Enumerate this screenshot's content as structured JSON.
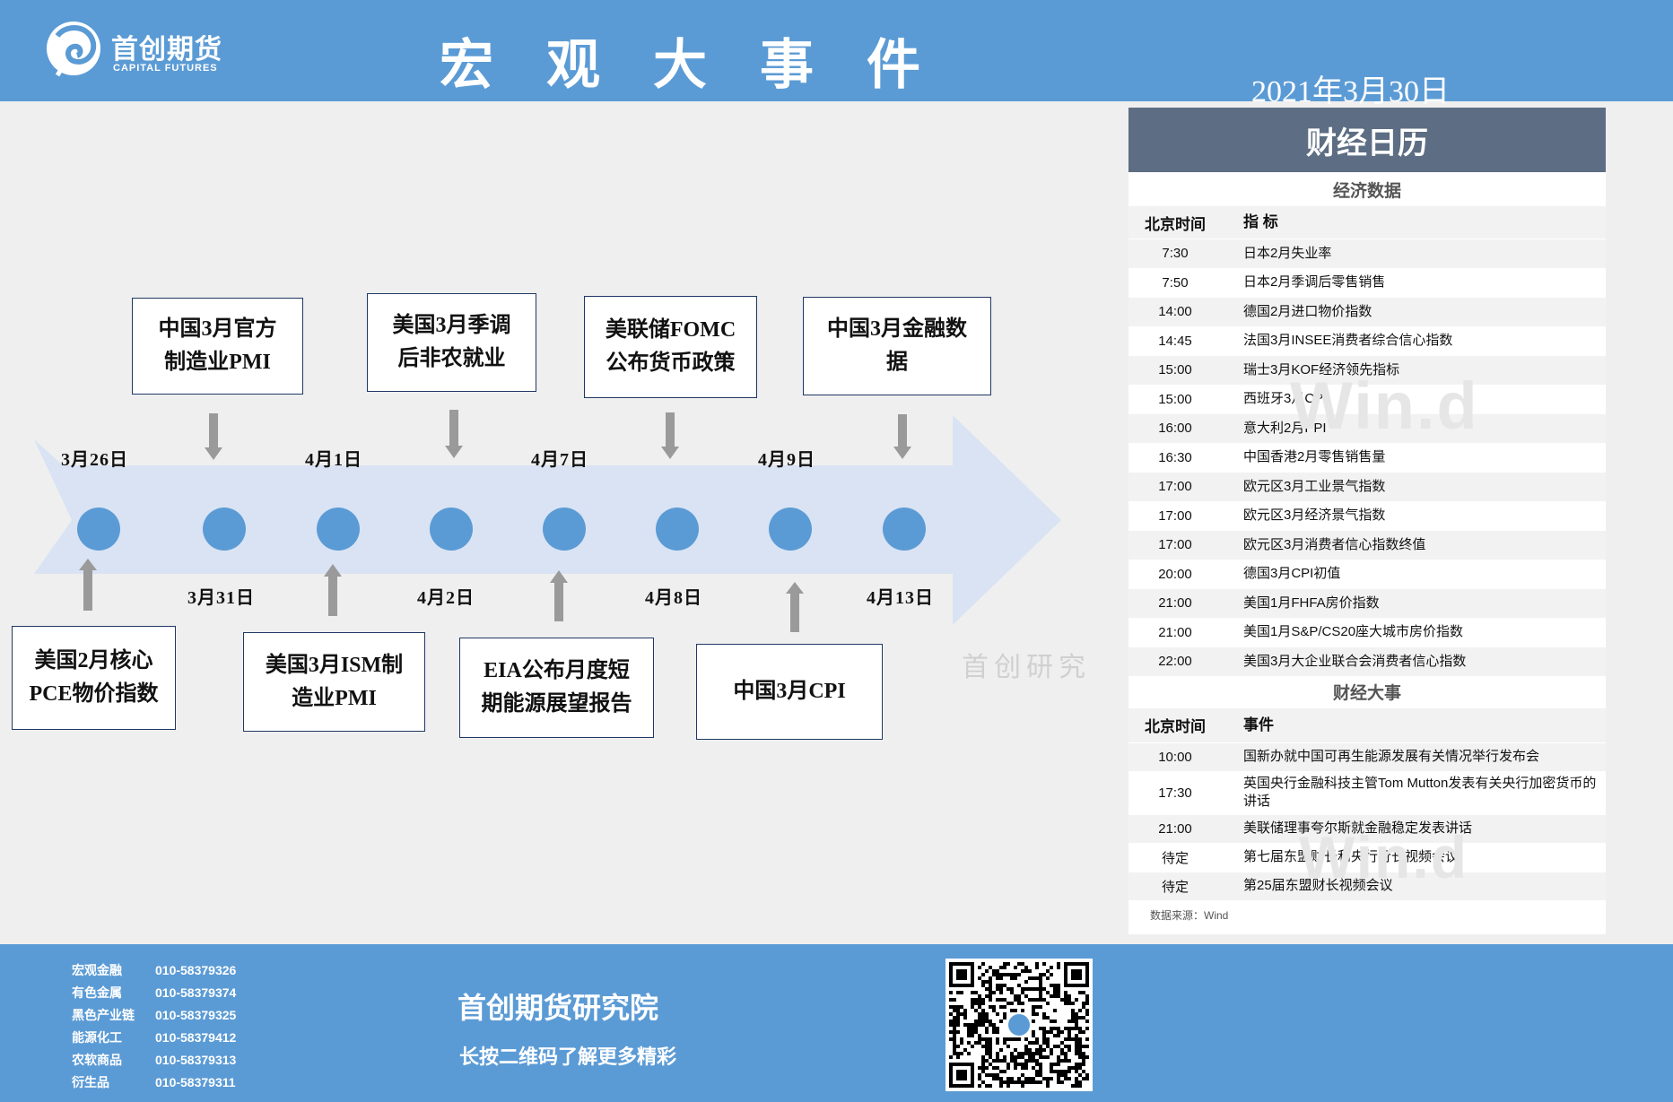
{
  "header": {
    "logo_cn": "首创期货",
    "logo_en": "CAPITAL FUTURES",
    "title": "宏 观 大 事 件",
    "date": "2021年3月30日"
  },
  "timeline": {
    "top_events": [
      {
        "line1": "中国3月官方",
        "line2": "制造业PMI"
      },
      {
        "line1": "美国3月季调",
        "line2": "后非农就业"
      },
      {
        "line1": "美联储FOMC",
        "line2": "公布货币政策"
      },
      {
        "line1": "中国3月金融数",
        "line2": "据"
      }
    ],
    "bottom_events": [
      {
        "line1": "美国2月核心",
        "line2": "PCE物价指数"
      },
      {
        "line1": "美国3月ISM制",
        "line2": "造业PMI"
      },
      {
        "line1": "EIA公布月度短",
        "line2": "期能源展望报告"
      },
      {
        "line1": "中国3月CPI",
        "line2": ""
      }
    ],
    "top_dates": [
      "3月26日",
      "4月1日",
      "4月7日",
      "4月9日"
    ],
    "bottom_dates": [
      "3月31日",
      "4月2日",
      "4月8日",
      "4月13日"
    ],
    "watermark": "首创研究"
  },
  "calendar": {
    "title": "财经日历",
    "economic": {
      "section_title": "经济数据",
      "col_time": "北京时间",
      "col_item": "指  标",
      "rows": [
        {
          "time": "7:30",
          "item": "日本2月失业率"
        },
        {
          "time": "7:50",
          "item": "日本2月季调后零售销售"
        },
        {
          "time": "14:00",
          "item": "德国2月进口物价指数"
        },
        {
          "time": "14:45",
          "item": "法国3月INSEE消费者综合信心指数"
        },
        {
          "time": "15:00",
          "item": "瑞士3月KOF经济领先指标"
        },
        {
          "time": "15:00",
          "item": "西班牙3月CPI"
        },
        {
          "time": "16:00",
          "item": "意大利2月PPI"
        },
        {
          "time": "16:30",
          "item": "中国香港2月零售销售量"
        },
        {
          "time": "17:00",
          "item": "欧元区3月工业景气指数"
        },
        {
          "time": "17:00",
          "item": "欧元区3月经济景气指数"
        },
        {
          "time": "17:00",
          "item": "欧元区3月消费者信心指数终值"
        },
        {
          "time": "20:00",
          "item": "德国3月CPI初值"
        },
        {
          "time": "21:00",
          "item": "美国1月FHFA房价指数"
        },
        {
          "time": "21:00",
          "item": "美国1月S&P/CS20座大城市房价指数"
        },
        {
          "time": "22:00",
          "item": "美国3月大企业联合会消费者信心指数"
        }
      ]
    },
    "events": {
      "section_title": "财经大事",
      "col_time": "北京时间",
      "col_item": "事件",
      "rows": [
        {
          "time": "10:00",
          "item": "国新办就中国可再生能源发展有关情况举行发布会"
        },
        {
          "time": "17:30",
          "item": "英国央行金融科技主管Tom Mutton发表有关央行加密货币的讲话"
        },
        {
          "time": "21:00",
          "item": "美联储理事夸尔斯就金融稳定发表讲话"
        },
        {
          "time": "待定",
          "item": "第七届东盟财长和央行行长视频会议"
        },
        {
          "time": "待定",
          "item": "第25届东盟财长视频会议"
        }
      ]
    },
    "source": "数据来源：Wind",
    "watermark": "Win.d"
  },
  "footer": {
    "contacts": [
      {
        "dept": "宏观金融",
        "phone": "010-58379326"
      },
      {
        "dept": "有色金属",
        "phone": "010-58379374"
      },
      {
        "dept": "黑色产业链",
        "phone": "010-58379325"
      },
      {
        "dept": "能源化工",
        "phone": "010-58379412"
      },
      {
        "dept": "农软商品",
        "phone": "010-58379313"
      },
      {
        "dept": "衍生品",
        "phone": "010-58379311"
      }
    ],
    "institute": "首创期货研究院",
    "slogan": "长按二维码了解更多精彩"
  },
  "colors": {
    "brand_blue": "#5b9bd5",
    "panel_head": "#5d6d83",
    "arrow_fill": "#d9e3f3",
    "box_border": "#1f3864"
  }
}
